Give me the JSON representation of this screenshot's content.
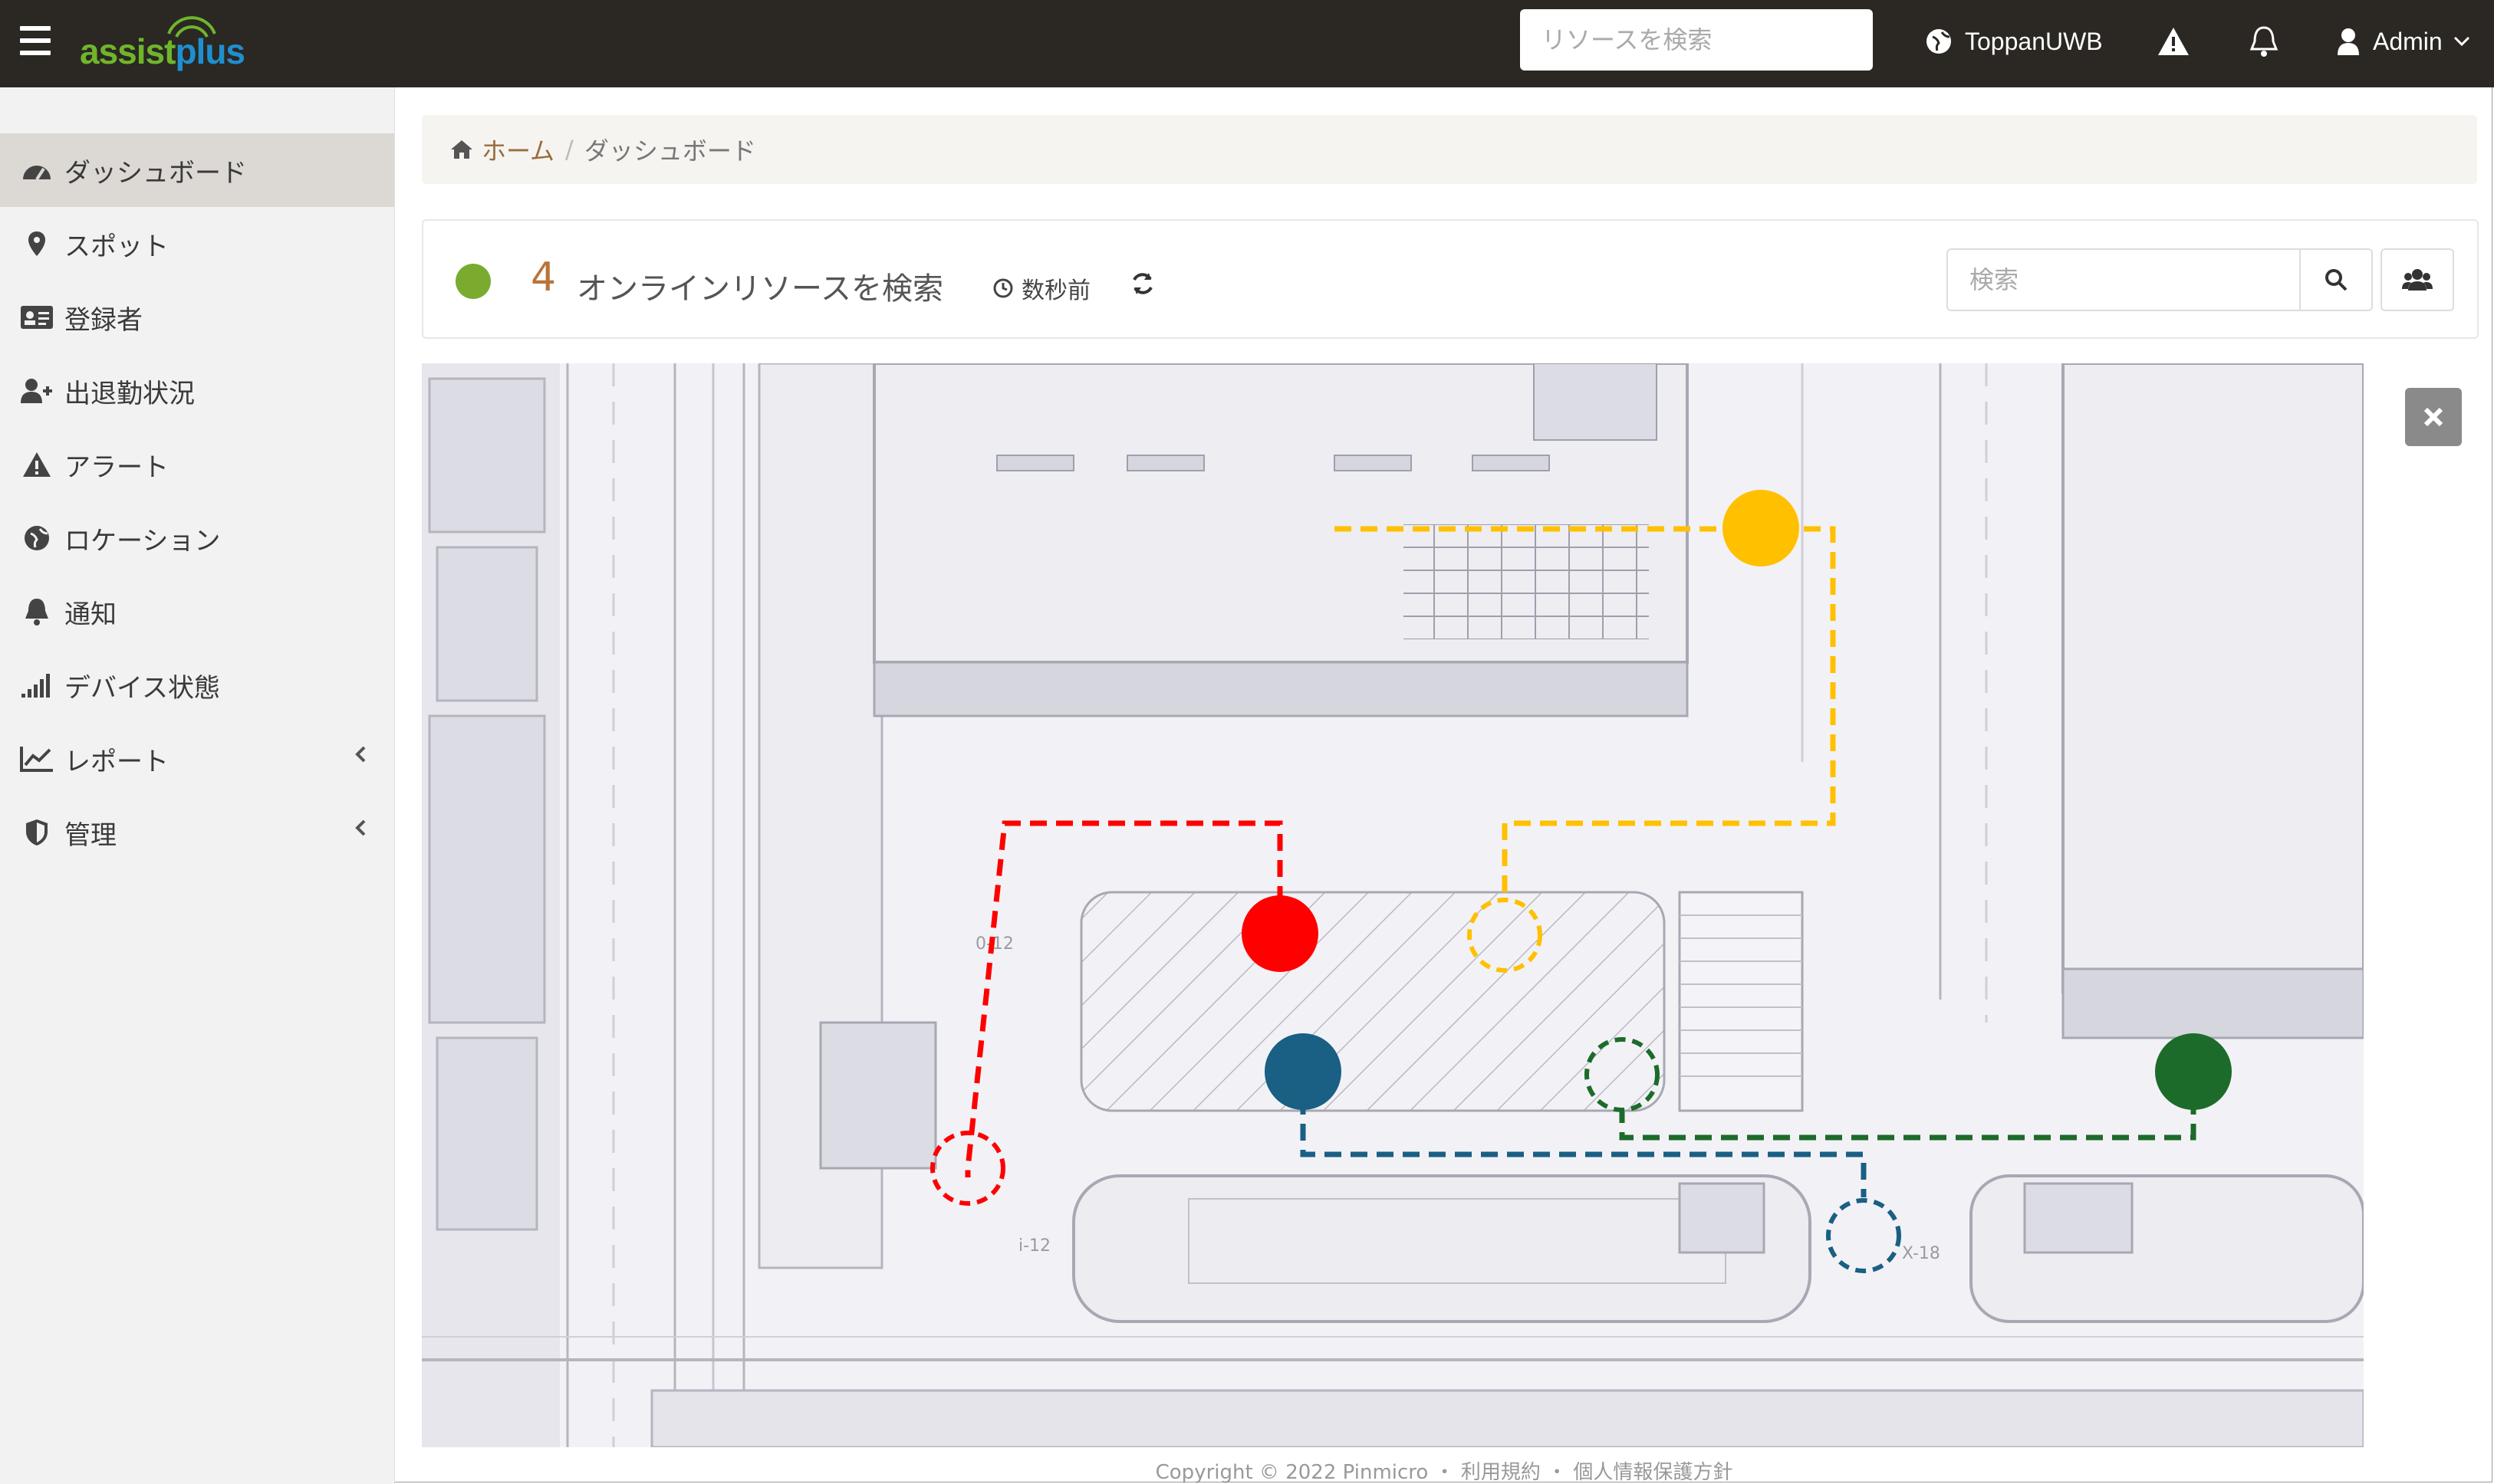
{
  "app": {
    "logo_part1": "assist",
    "logo_part2": "plus",
    "search_placeholder": "リソースを検索",
    "tenant": "ToppanUWB",
    "user": "Admin"
  },
  "sidebar": {
    "items": [
      {
        "label": "ダッシュボード",
        "icon": "dashboard-icon"
      },
      {
        "label": "スポット",
        "icon": "map-marker-icon"
      },
      {
        "label": "登録者",
        "icon": "id-card-icon"
      },
      {
        "label": "出退勤状況",
        "icon": "user-plus-icon"
      },
      {
        "label": "アラート",
        "icon": "warning-icon"
      },
      {
        "label": "ロケーション",
        "icon": "globe-icon"
      },
      {
        "label": "通知",
        "icon": "bell-icon"
      },
      {
        "label": "デバイス状態",
        "icon": "signal-icon"
      },
      {
        "label": "レポート",
        "icon": "line-chart-icon"
      },
      {
        "label": "管理",
        "icon": "shield-icon"
      }
    ]
  },
  "breadcrumb": {
    "home": "ホーム",
    "separator": "/",
    "current": "ダッシュボード"
  },
  "panel": {
    "count": "4",
    "title": "オンラインリソースを検索",
    "updated": "数秒前",
    "search_placeholder": "検索",
    "status_color": "#7aab2e"
  },
  "map": {
    "labels": [
      "0-12",
      "i-12",
      "X-18"
    ],
    "markers": [
      {
        "color": "#ff0000",
        "state": "current"
      },
      {
        "color": "#ffc000",
        "state": "current"
      },
      {
        "color": "#1a5f84",
        "state": "current"
      },
      {
        "color": "#1c6b2a",
        "state": "current"
      }
    ]
  },
  "footer": {
    "text": "Copyright © 2022 Pinmicro ・ 利用規約 ・ 個人情報保護方針"
  }
}
